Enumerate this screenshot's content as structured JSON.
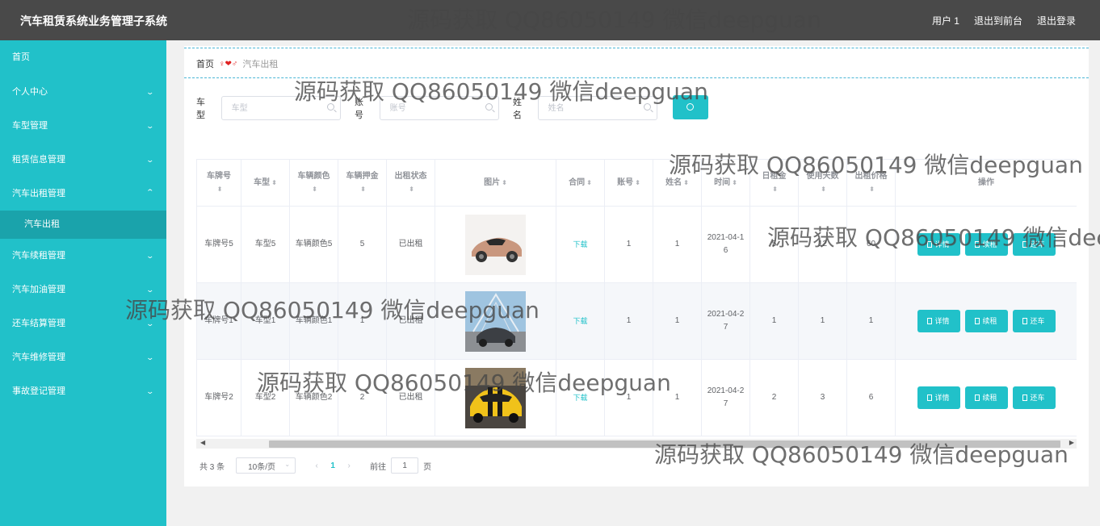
{
  "header": {
    "title": "汽车租赁系统业务管理子系统",
    "user": "用户 1",
    "back_to_front": "退出到前台",
    "logout": "退出登录"
  },
  "sidebar": {
    "items": [
      {
        "label": "首页"
      },
      {
        "label": "个人中心"
      },
      {
        "label": "车型管理"
      },
      {
        "label": "租赁信息管理"
      },
      {
        "label": "汽车出租管理"
      },
      {
        "label": "汽车续租管理"
      },
      {
        "label": "汽车加油管理"
      },
      {
        "label": "还车结算管理"
      },
      {
        "label": "汽车维修管理"
      },
      {
        "label": "事故登记管理"
      }
    ],
    "active_sub": "汽车出租"
  },
  "breadcrumb": {
    "home": "首页",
    "current": "汽车出租"
  },
  "search": {
    "car_type_label": "车型",
    "car_type_placeholder": "车型",
    "account_label": "账号",
    "account_placeholder": "账号",
    "name_label": "姓名",
    "name_placeholder": "姓名"
  },
  "table": {
    "columns": [
      "车牌号",
      "车型",
      "车辆颜色",
      "车辆押金",
      "出租状态",
      "图片",
      "合同",
      "账号",
      "姓名",
      "时间",
      "日租金",
      "使用天数",
      "出租价格",
      "操作"
    ],
    "download_label": "下载",
    "op_labels": {
      "detail": "详情",
      "renew": "续租",
      "return": "还车"
    },
    "rows": [
      {
        "plate": "车牌号5",
        "type": "车型5",
        "color": "车辆颜色5",
        "deposit": "5",
        "status": "已出租",
        "account": "1",
        "name": "1",
        "time": "2021-04-16",
        "daily": "5",
        "days": "12",
        "price": "60"
      },
      {
        "plate": "车牌号1",
        "type": "车型1",
        "color": "车辆颜色1",
        "deposit": "1",
        "status": "已出租",
        "account": "1",
        "name": "1",
        "time": "2021-04-27",
        "daily": "1",
        "days": "1",
        "price": "1"
      },
      {
        "plate": "车牌号2",
        "type": "车型2",
        "color": "车辆颜色2",
        "deposit": "2",
        "status": "已出租",
        "account": "1",
        "name": "1",
        "time": "2021-04-27",
        "daily": "2",
        "days": "3",
        "price": "6"
      }
    ]
  },
  "pagination": {
    "total": "共 3 条",
    "page_size": "10条/页",
    "current_page": "1",
    "goto_label": "前往",
    "goto_value": "1",
    "page_suffix": "页"
  },
  "watermark": "源码获取 QQ86050149 微信deepguan",
  "colors": {
    "accent": "#21c1c9",
    "header_bg": "#494949",
    "sub_active": "#1aa3ab"
  }
}
